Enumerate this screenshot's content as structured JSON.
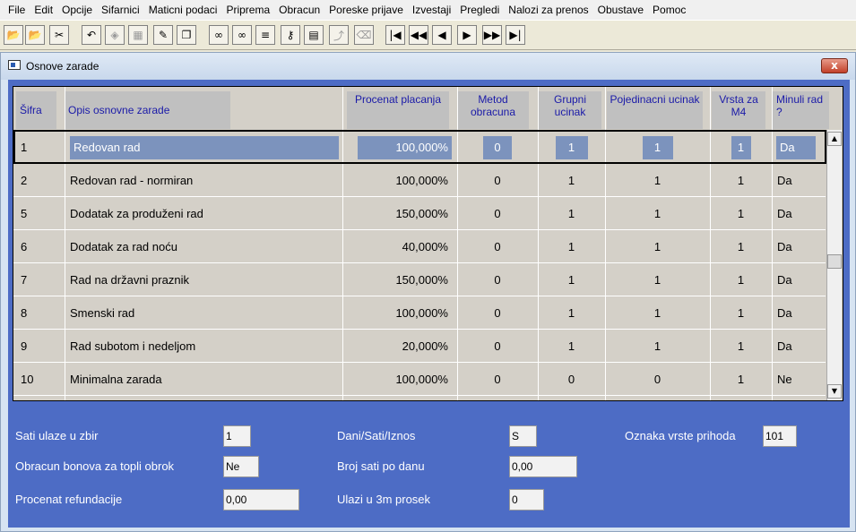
{
  "menu": [
    "File",
    "Edit",
    "Opcije",
    "Sifarnici",
    "Maticni podaci",
    "Priprema",
    "Obracun",
    "Poreske prijave",
    "Izvestaji",
    "Pregledi",
    "Nalozi za prenos",
    "Obustave",
    "Pomoc"
  ],
  "toolbar": {
    "icons": [
      "open-folder-icon",
      "folder-icon",
      "tools-icon",
      "undo-arrow-icon",
      "diamond-icon",
      "grid-icon",
      "edit-icon",
      "copy-icon",
      "binoculars-icon",
      "binoculars-plus-icon",
      "list-icon",
      "key-icon",
      "table-icon",
      "branch-icon",
      "eraser-icon",
      "first-record-icon",
      "prev-page-icon",
      "prev-record-icon",
      "next-record-icon",
      "next-page-icon",
      "last-record-icon"
    ],
    "glyphs": [
      "📂",
      "📂",
      "✂",
      "↶",
      "◈",
      "▦",
      "✎",
      "❐",
      "∞",
      "∞",
      "≡",
      "⚷",
      "▤",
      "⤴",
      "⌫",
      "|◀",
      "◀◀",
      "◀",
      "▶",
      "▶▶",
      "▶|"
    ]
  },
  "window": {
    "title": "Osnove zarade",
    "close_label": "x"
  },
  "grid": {
    "headers": [
      "Šifra",
      "Opis osnovne zarade",
      "Procenat placanja",
      "Metod obracuna",
      "Grupni ucinak",
      "Pojedinacni ucinak",
      "Vrsta za M4",
      "Minuli rad ?"
    ],
    "rows": [
      [
        "1",
        "Redovan rad",
        "100,000%",
        "0",
        "1",
        "1",
        "1",
        "Da"
      ],
      [
        "2",
        "Redovan rad - normiran",
        "100,000%",
        "0",
        "1",
        "1",
        "1",
        "Da"
      ],
      [
        "5",
        "Dodatak za produženi rad",
        "150,000%",
        "0",
        "1",
        "1",
        "1",
        "Da"
      ],
      [
        "6",
        "Dodatak za rad noću",
        "40,000%",
        "0",
        "1",
        "1",
        "1",
        "Da"
      ],
      [
        "7",
        "Rad na državni praznik",
        "150,000%",
        "0",
        "1",
        "1",
        "1",
        "Da"
      ],
      [
        "8",
        "Smenski rad",
        "100,000%",
        "0",
        "1",
        "1",
        "1",
        "Da"
      ],
      [
        "9",
        "Rad subotom i nedeljom",
        "20,000%",
        "0",
        "1",
        "1",
        "1",
        "Da"
      ],
      [
        "10",
        "Minimalna zarada",
        "100,000%",
        "0",
        "0",
        "0",
        "1",
        "Ne"
      ]
    ]
  },
  "form": {
    "sati_ulaze_label": "Sati ulaze u zbir",
    "sati_ulaze_value": "1",
    "topli_obrok_label": "Obracun bonova za topli obrok",
    "topli_obrok_value": "Ne",
    "refundacija_label": "Procenat refundacije",
    "refundacija_value": "0,00",
    "dani_label": "Dani/Sati/Iznos",
    "dani_value": "S",
    "broj_sati_label": "Broj sati po danu",
    "broj_sati_value": "0,00",
    "prosek_label": "Ulazi u 3m prosek",
    "prosek_value": "0",
    "oznaka_label": "Oznaka vrste prihoda",
    "oznaka_value": "101"
  }
}
